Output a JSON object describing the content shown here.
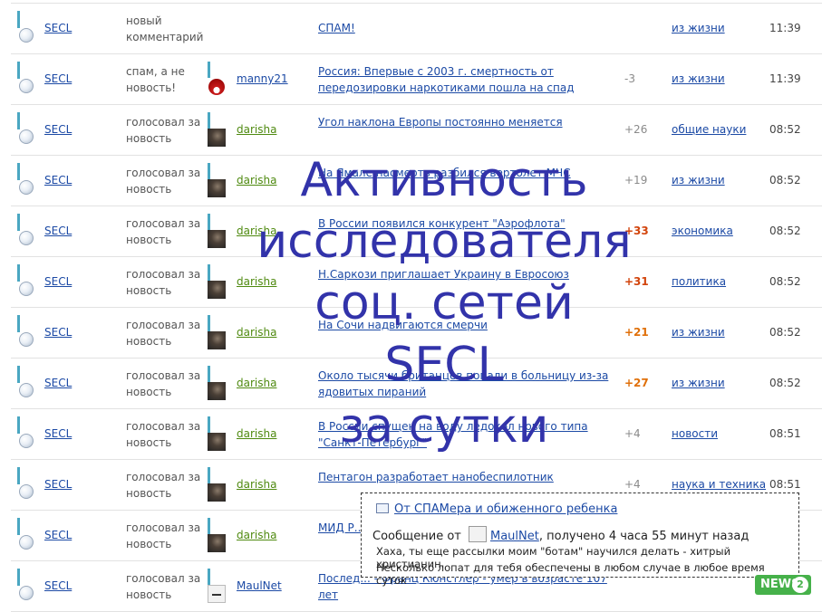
{
  "rows": [
    {
      "user": "SECL",
      "action": "новый комментарий",
      "author": "",
      "author_pic": "none",
      "title": "СПАМ!",
      "title_single": true,
      "score": "",
      "score_style": "",
      "category": "из жизни",
      "time": "11:39"
    },
    {
      "user": "SECL",
      "action": "спам, а не новость!",
      "author": "manny21",
      "author_pic": "red",
      "title": "Россия: Впервые с 2003 г. смертность от передозировки наркотиками пошла на спад",
      "score": "-3",
      "score_style": "",
      "category": "из жизни",
      "time": "11:39"
    },
    {
      "user": "SECL",
      "action": "голосовал за новость",
      "author": "darisha",
      "author_pic": "dark",
      "title": "Угол наклона Европы постоянно меняется",
      "score": "+26",
      "score_style": "",
      "category": "общие науки",
      "time": "08:52"
    },
    {
      "user": "SECL",
      "action": "голосовал за новость",
      "author": "darisha",
      "author_pic": "dark",
      "title": "На Ямале насмерть разбился вертолет МЧС",
      "score": "+19",
      "score_style": "",
      "category": "из жизни",
      "time": "08:52"
    },
    {
      "user": "SECL",
      "action": "голосовал за новость",
      "author": "darisha",
      "author_pic": "dark",
      "title": "В России появился конкурент \"Аэрофлота\"",
      "score": "+33",
      "score_style": "red",
      "category": "экономика",
      "time": "08:52"
    },
    {
      "user": "SECL",
      "action": "голосовал за новость",
      "author": "darisha",
      "author_pic": "dark",
      "title": "Н.Саркози приглашает Украину в Евросоюз",
      "score": "+31",
      "score_style": "red",
      "category": "политика",
      "time": "08:52"
    },
    {
      "user": "SECL",
      "action": "голосовал за новость",
      "author": "darisha",
      "author_pic": "dark",
      "title": "На Сочи надвигаются смерчи",
      "score": "+21",
      "score_style": "hot",
      "category": "из жизни",
      "time": "08:52"
    },
    {
      "user": "SECL",
      "action": "голосовал за новость",
      "author": "darisha",
      "author_pic": "dark",
      "title": "Около тысячи британцев попали в больницу из-за ядовитых пираний",
      "score": "+27",
      "score_style": "hot",
      "category": "из жизни",
      "time": "08:52"
    },
    {
      "user": "SECL",
      "action": "голосовал за новость",
      "author": "darisha",
      "author_pic": "dark",
      "title": "В России спущен на воду ледокол нового типа \"Санкт-Петербург\"",
      "score": "+4",
      "score_style": "",
      "category": "новости",
      "time": "08:51"
    },
    {
      "user": "SECL",
      "action": "голосовал за новость",
      "author": "darisha",
      "author_pic": "dark",
      "title": "Пентагон разработает нанобеспилотник",
      "score": "+4",
      "score_style": "",
      "category": "наука и техника",
      "time": "08:51"
    },
    {
      "user": "SECL",
      "action": "голосовал за новость",
      "author": "darisha",
      "author_pic": "dark",
      "title": "МИД Р... провок...",
      "score": "",
      "score_style": "",
      "category": "",
      "time": ""
    },
    {
      "user": "SECL",
      "action": "голосовал за новость",
      "author": "MaulNet",
      "author_pic": "doc",
      "title": "Послед... - Франц Кюнстлер - умер в возрасте 107 лет",
      "score": "",
      "score_style": "",
      "category": "",
      "time": ""
    }
  ],
  "overlay": {
    "lines": [
      "Активность",
      "исследователя",
      "соц. сетей",
      "SECL",
      "за сутки"
    ]
  },
  "popup": {
    "header": "От СПАМера и обиженного ребенка",
    "msg_prefix": "Сообщение от",
    "msg_user": "MaulNet",
    "msg_suffix": ", получено 4 часа 55 минут назад",
    "line1": "Хаха, ты еще рассылки моим \"ботам\" научился делать - хитрый христианин.",
    "line2": "Несколько лопат для тебя обеспечены в любом случае в любое время суток"
  },
  "badge": {
    "text": "NEWS",
    "circle": "2"
  }
}
